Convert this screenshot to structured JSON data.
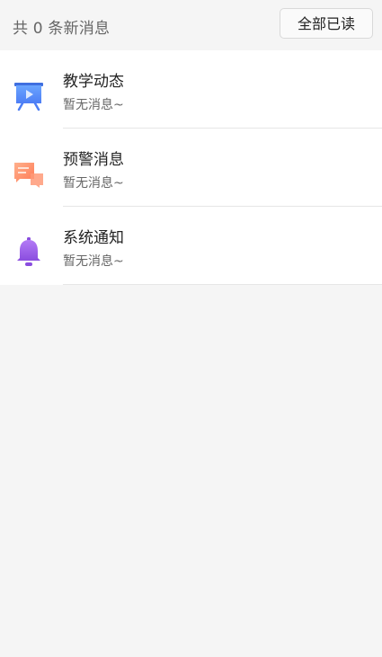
{
  "header": {
    "count_text": "共 0 条新消息",
    "mark_all_label": "全部已读"
  },
  "items": [
    {
      "title": "教学动态",
      "subtitle": "暂无消息~",
      "icon": "presentation-board-icon",
      "color": "#5b8ff9"
    },
    {
      "title": "预警消息",
      "subtitle": "暂无消息~",
      "icon": "chat-bubble-icon",
      "color": "#ff8c69"
    },
    {
      "title": "系统通知",
      "subtitle": "暂无消息~",
      "icon": "bell-icon",
      "color": "#9b5de5"
    }
  ]
}
